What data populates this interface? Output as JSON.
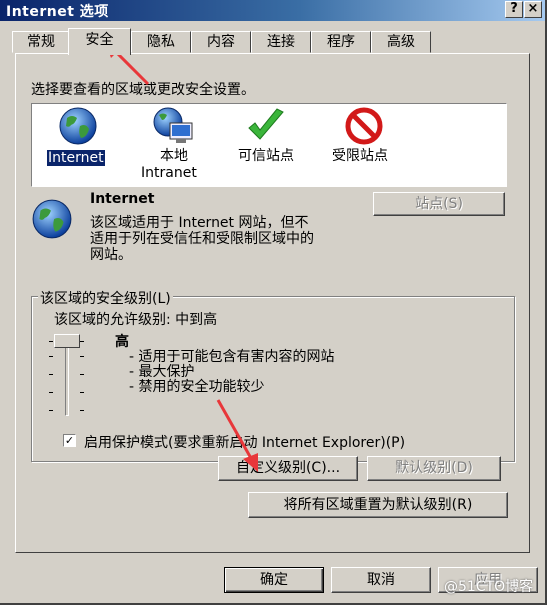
{
  "window": {
    "title": "Internet 选项",
    "help_glyph": "?",
    "close_glyph": "×"
  },
  "tabs": [
    {
      "label": "常规"
    },
    {
      "label": "安全"
    },
    {
      "label": "隐私"
    },
    {
      "label": "内容"
    },
    {
      "label": "连接"
    },
    {
      "label": "程序"
    },
    {
      "label": "高级"
    }
  ],
  "active_tab": "安全",
  "security": {
    "prompt": "选择要查看的区域或更改安全设置。",
    "zones": [
      {
        "label": "Internet",
        "icon": "globe-icon",
        "selected": true
      },
      {
        "label": "本地",
        "label2": "Intranet",
        "icon": "local-intranet-icon"
      },
      {
        "label": "可信站点",
        "icon": "checkmark-icon"
      },
      {
        "label": "受限站点",
        "icon": "restricted-icon"
      }
    ],
    "zone_name": "Internet",
    "zone_desc": [
      "该区域适用于 Internet 网站，但不",
      "适用于列在受信任和受限制区域中的",
      "网站。"
    ],
    "sites_button": "站点(S)",
    "level_group_title": "该区域的安全级别(L)",
    "allowed_levels": "该区域的允许级别: 中到高",
    "level_name": "高",
    "level_desc": [
      "- 适用于可能包含有害内容的网站",
      "- 最大保护",
      "- 禁用的安全功能较少"
    ],
    "protected_mode_label": "启用保护模式(要求重新启动 Internet Explorer)(P)",
    "protected_mode_checked": true,
    "custom_level_button": "自定义级别(C)...",
    "default_level_button": "默认级别(D)",
    "reset_all_button": "将所有区域重置为默认级别(R)"
  },
  "footer": {
    "ok": "确定",
    "cancel": "取消",
    "apply": "应用",
    "watermark": "@51CTO博客"
  },
  "colors": {
    "face": "#d4d0c8",
    "title_start": "#0a246a",
    "selection": "#0a246a",
    "annotation": "#e8373a"
  }
}
